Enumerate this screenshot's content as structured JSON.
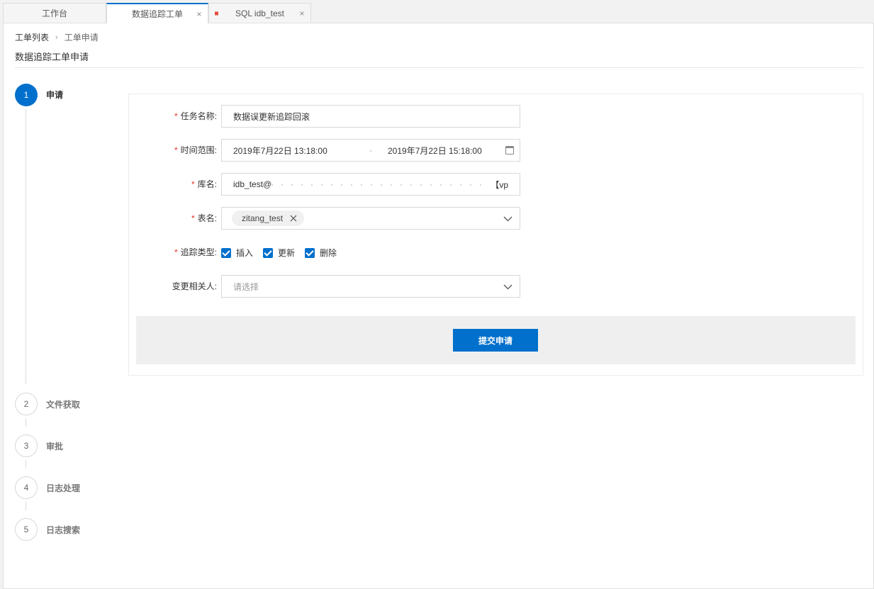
{
  "tabs": [
    {
      "label": "工作台"
    },
    {
      "label": "数据追踪工单",
      "close": "×"
    },
    {
      "label": "SQL idb_test",
      "close": "×"
    }
  ],
  "breadcrumb": {
    "root": "工单列表",
    "sep": "›",
    "current": "工单申请"
  },
  "page_title": "数据追踪工单申请",
  "steps": [
    {
      "num": "1",
      "label": "申请"
    },
    {
      "num": "2",
      "label": "文件获取"
    },
    {
      "num": "3",
      "label": "审批"
    },
    {
      "num": "4",
      "label": "日志处理"
    },
    {
      "num": "5",
      "label": "日志搜索"
    }
  ],
  "form": {
    "required_mark": "*",
    "task_name": {
      "label": "任务名称:",
      "value": "数据误更新追踪回滚"
    },
    "time_range": {
      "label": "时间范围:",
      "start": "2019年7月22日 13:18:00",
      "sep": "-",
      "end": "2019年7月22日 15:18:00"
    },
    "database": {
      "label": "库名:",
      "value": "idb_test@",
      "tail": "【vp"
    },
    "table": {
      "label": "表名:",
      "tag": "zitang_test"
    },
    "track_type": {
      "label": "追踪类型:",
      "options": [
        "插入",
        "更新",
        "删除"
      ]
    },
    "change_people": {
      "label": "变更相关人:",
      "placeholder": "请选择"
    },
    "submit_label": "提交申请"
  },
  "colors": {
    "accent": "#0070cc",
    "required": "#e0331f",
    "tab_dot": "#e24c3d"
  }
}
